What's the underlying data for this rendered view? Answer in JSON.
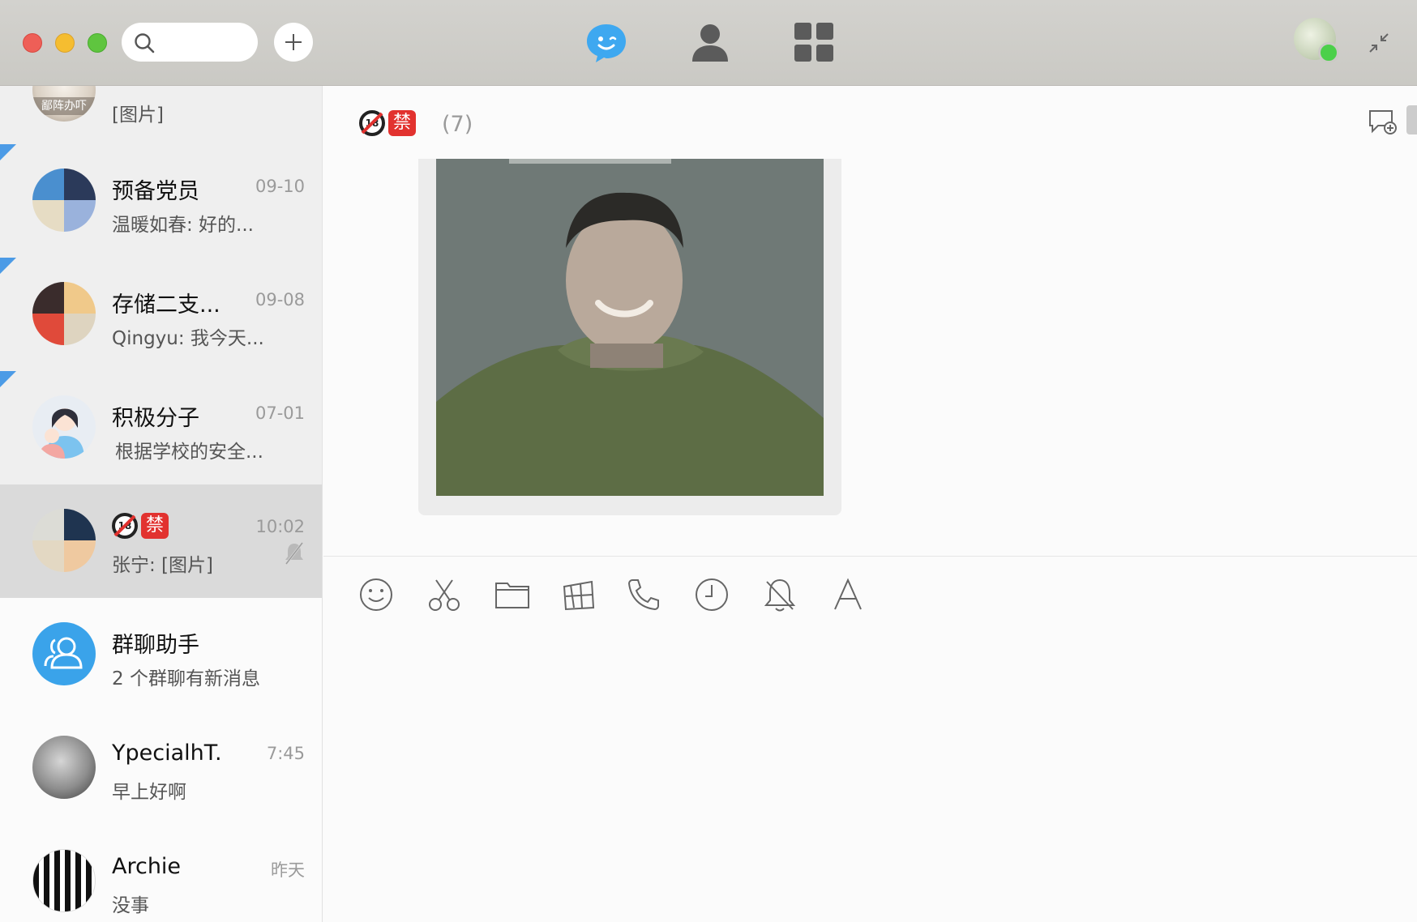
{
  "titlebar": {
    "search_placeholder": "",
    "nav": [
      "chat",
      "contacts",
      "apps"
    ],
    "colors": {
      "active_nav": "#3ea8f0",
      "inactive_nav": "#5b5b5b",
      "online": "#4cd04a"
    }
  },
  "sidebar": {
    "items": [
      {
        "name": "",
        "time": "",
        "msg": "[图片]",
        "pinned": false
      },
      {
        "name": "预备党员",
        "time": "09-10",
        "msg": "温暖如春: 好的...",
        "pinned": true
      },
      {
        "name": "存储二支...",
        "time": "09-08",
        "msg": "Qingyu: 我今天...",
        "pinned": true
      },
      {
        "name": "积极分子",
        "time": "07-01",
        "msg": "根据学校的安全...",
        "pinned": true
      },
      {
        "name": "",
        "time": "10:02",
        "msg": "张宁: [图片]",
        "pinned": false,
        "selected": true,
        "muted": true
      },
      {
        "name": "群聊助手",
        "time": "",
        "msg": "2 个群聊有新消息"
      },
      {
        "name": "YpecialhT.",
        "time": "7:45",
        "msg": "早上好啊"
      },
      {
        "name": "Archie",
        "time": "昨天",
        "msg": "没事"
      }
    ],
    "avatar_overlay_text": "鄙阵办吓"
  },
  "chat": {
    "title_badges": [
      "🔞",
      "禁"
    ],
    "member_count": "(7)",
    "badge_18": "18",
    "badge_jin": "禁"
  },
  "toolbar": {
    "tools": [
      "emoji-icon",
      "scissors-icon",
      "folder-icon",
      "screenshot-icon",
      "phone-icon",
      "clock-icon",
      "bell-off-icon",
      "font-icon"
    ]
  }
}
